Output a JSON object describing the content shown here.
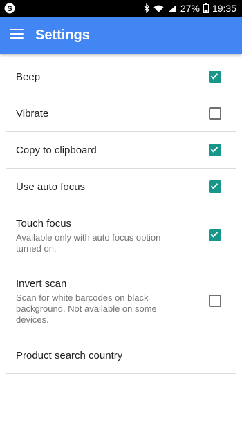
{
  "status_bar": {
    "battery": "27%",
    "time": "19:35"
  },
  "app_bar": {
    "title": "Settings"
  },
  "settings": [
    {
      "label": "Beep",
      "summary": "",
      "checked": true,
      "has_checkbox": true
    },
    {
      "label": "Vibrate",
      "summary": "",
      "checked": false,
      "has_checkbox": true
    },
    {
      "label": "Copy to clipboard",
      "summary": "",
      "checked": true,
      "has_checkbox": true
    },
    {
      "label": "Use auto focus",
      "summary": "",
      "checked": true,
      "has_checkbox": true
    },
    {
      "label": "Touch focus",
      "summary": "Available only with auto focus option turned on.",
      "checked": true,
      "has_checkbox": true
    },
    {
      "label": "Invert scan",
      "summary": "Scan for white barcodes on black background. Not available on some devices.",
      "checked": false,
      "has_checkbox": true
    },
    {
      "label": "Product search country",
      "summary": "",
      "has_checkbox": false
    }
  ],
  "colors": {
    "app_bar": "#4286f4",
    "checkbox_checked": "#16978a",
    "checkbox_unchecked": "#707070"
  }
}
